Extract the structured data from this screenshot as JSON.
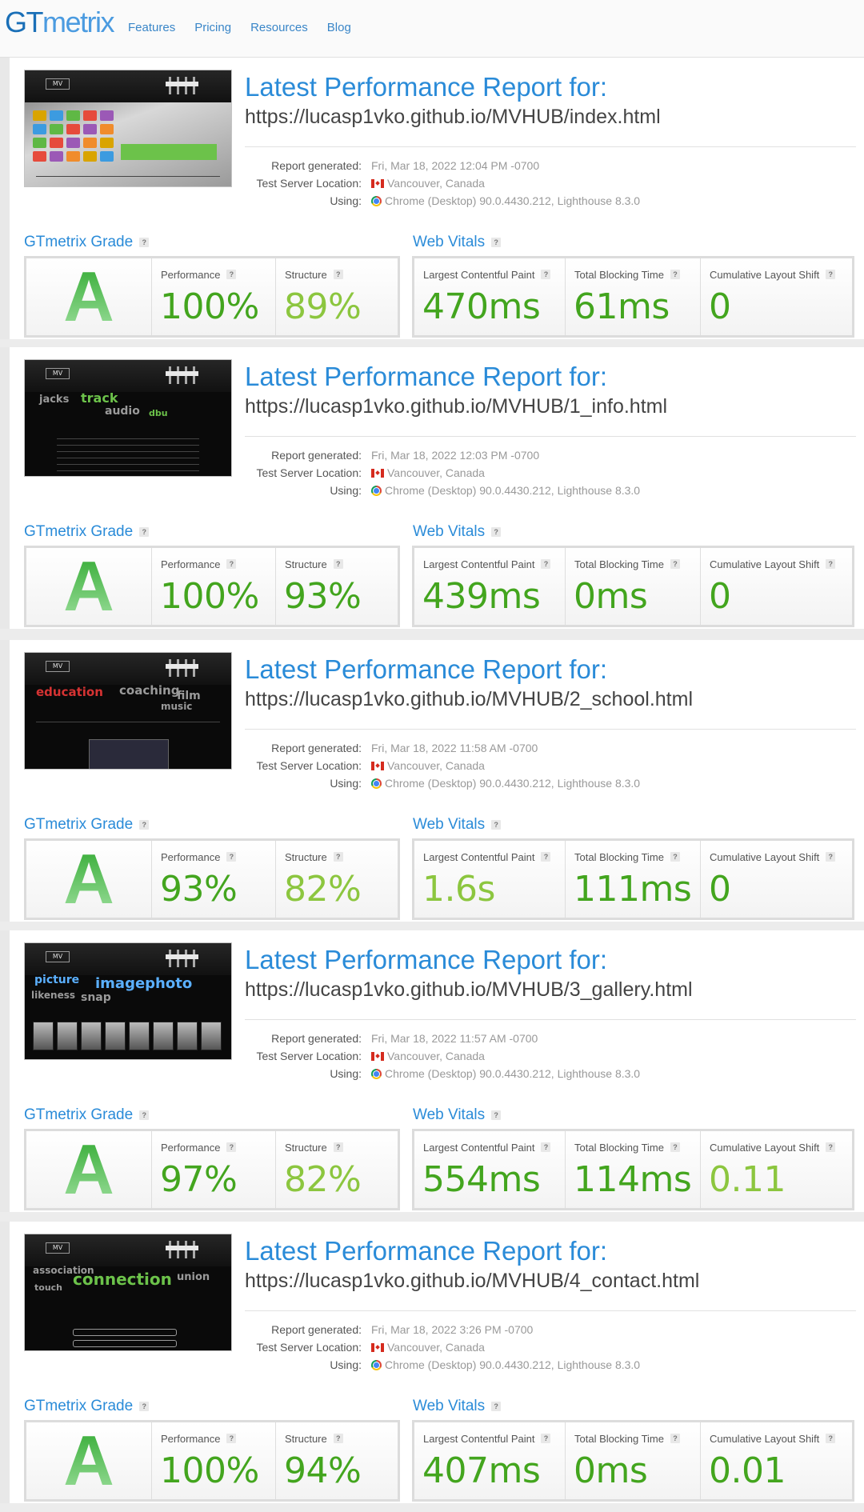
{
  "site": {
    "logo_gt": "GT",
    "logo_metrix": "metrix",
    "nav": [
      "Features",
      "Pricing",
      "Resources",
      "Blog"
    ]
  },
  "labels": {
    "report_title": "Latest Performance Report for:",
    "report_generated": "Report generated:",
    "test_server": "Test Server Location:",
    "using": "Using:",
    "grade_section": "GTmetrix Grade",
    "vitals_section": "Web Vitals",
    "performance": "Performance",
    "structure": "Structure",
    "lcp": "Largest Contentful Paint",
    "tbt": "Total Blocking Time",
    "cls": "Cumulative Layout Shift",
    "help": "?"
  },
  "colors": {
    "brand_blue": "#2a8bd8",
    "grade_green": "#2ca52c",
    "value_green": "#43a51e",
    "value_lightgreen": "#8cc63f"
  },
  "reports": [
    {
      "thumb_style": "index",
      "url": "https://lucasp1vko.github.io/MVHUB/index.html",
      "generated": "Fri, Mar 18, 2022 12:04 PM -0700",
      "location": "Vancouver, Canada",
      "using": "Chrome (Desktop) 90.0.4430.212, Lighthouse 8.3.0",
      "grade": "A",
      "performance": "100%",
      "performance_tone": "green",
      "structure": "89%",
      "structure_tone": "lightgreen",
      "lcp": "470ms",
      "lcp_tone": "green",
      "tbt": "61ms",
      "tbt_tone": "green",
      "cls": "0",
      "cls_tone": "green"
    },
    {
      "thumb_style": "info",
      "url": "https://lucasp1vko.github.io/MVHUB/1_info.html",
      "generated": "Fri, Mar 18, 2022 12:03 PM -0700",
      "location": "Vancouver, Canada",
      "using": "Chrome (Desktop) 90.0.4430.212, Lighthouse 8.3.0",
      "grade": "A",
      "performance": "100%",
      "performance_tone": "green",
      "structure": "93%",
      "structure_tone": "green",
      "lcp": "439ms",
      "lcp_tone": "green",
      "tbt": "0ms",
      "tbt_tone": "green",
      "cls": "0",
      "cls_tone": "green"
    },
    {
      "thumb_style": "school",
      "url": "https://lucasp1vko.github.io/MVHUB/2_school.html",
      "generated": "Fri, Mar 18, 2022 11:58 AM -0700",
      "location": "Vancouver, Canada",
      "using": "Chrome (Desktop) 90.0.4430.212, Lighthouse 8.3.0",
      "grade": "A",
      "performance": "93%",
      "performance_tone": "green",
      "structure": "82%",
      "structure_tone": "lightgreen",
      "lcp": "1.6s",
      "lcp_tone": "lightgreen",
      "tbt": "111ms",
      "tbt_tone": "green",
      "cls": "0",
      "cls_tone": "green"
    },
    {
      "thumb_style": "gallery",
      "url": "https://lucasp1vko.github.io/MVHUB/3_gallery.html",
      "generated": "Fri, Mar 18, 2022 11:57 AM -0700",
      "location": "Vancouver, Canada",
      "using": "Chrome (Desktop) 90.0.4430.212, Lighthouse 8.3.0",
      "grade": "A",
      "performance": "97%",
      "performance_tone": "green",
      "structure": "82%",
      "structure_tone": "lightgreen",
      "lcp": "554ms",
      "lcp_tone": "green",
      "tbt": "114ms",
      "tbt_tone": "green",
      "cls": "0.11",
      "cls_tone": "lightgreen"
    },
    {
      "thumb_style": "contact",
      "url": "https://lucasp1vko.github.io/MVHUB/4_contact.html",
      "generated": "Fri, Mar 18, 2022 3:26 PM -0700",
      "location": "Vancouver, Canada",
      "using": "Chrome (Desktop) 90.0.4430.212, Lighthouse 8.3.0",
      "grade": "A",
      "performance": "100%",
      "performance_tone": "green",
      "structure": "94%",
      "structure_tone": "green",
      "lcp": "407ms",
      "lcp_tone": "green",
      "tbt": "0ms",
      "tbt_tone": "green",
      "cls": "0.01",
      "cls_tone": "green"
    }
  ]
}
